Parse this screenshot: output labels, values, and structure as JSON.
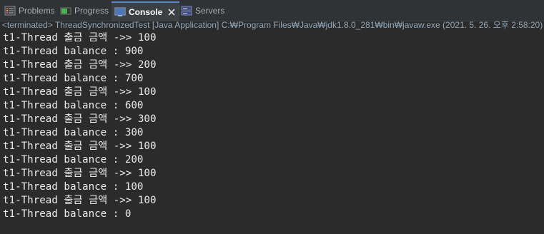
{
  "tabs": [
    {
      "label": "Problems",
      "icon": "problems-icon"
    },
    {
      "label": "Progress",
      "icon": "progress-icon"
    },
    {
      "label": "Console",
      "icon": "console-icon",
      "active": true
    },
    {
      "label": "Servers",
      "icon": "servers-icon"
    }
  ],
  "status_line": "<terminated> ThreadSynchronizedTest [Java Application] C:₩Program Files₩Java₩jdk1.8.0_281₩bin₩javaw.exe (2021. 5. 26. 오후 2:58:20)",
  "console_lines": [
    "t1-Thread 출금 금액 ->> 100",
    "t1-Thread balance : 900",
    "t1-Thread 출금 금액 ->> 200",
    "t1-Thread balance : 700",
    "t1-Thread 출금 금액 ->> 100",
    "t1-Thread balance : 600",
    "t1-Thread 출금 금액 ->> 300",
    "t1-Thread balance : 300",
    "t1-Thread 출금 금액 ->> 100",
    "t1-Thread balance : 200",
    "t1-Thread 출금 금액 ->> 100",
    "t1-Thread balance : 100",
    "t1-Thread 출금 금액 ->> 100",
    "t1-Thread balance : 0"
  ],
  "colors": {
    "background": "#2b2b2b",
    "text": "#ebebeb",
    "status_text": "#8fa8bc",
    "active_tab_accent": "#5a88c8"
  }
}
